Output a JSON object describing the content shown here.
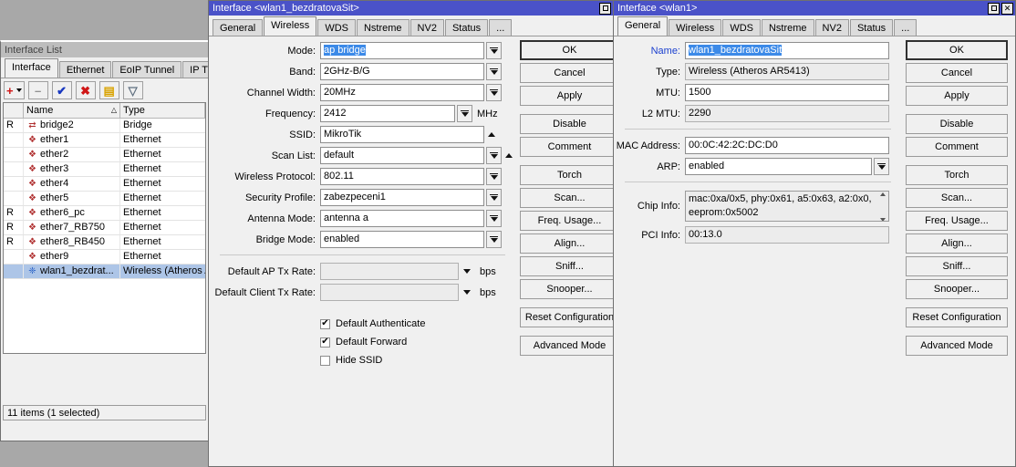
{
  "colors": {
    "title_active": "#4a52c8",
    "title_inactive": "#bdbdbd",
    "selection": "#adc5e7",
    "field_select": "#3c8ae8",
    "modified_label": "#1a3fcf",
    "window_bg": "#f0f0f0",
    "desktop": "#a8a8a8"
  },
  "interface_list": {
    "title": "Interface List",
    "tabs": [
      {
        "label": "Interface",
        "active": true
      },
      {
        "label": "Ethernet",
        "active": false
      },
      {
        "label": "EoIP Tunnel",
        "active": false
      },
      {
        "label": "IP Tunnel",
        "active": false
      }
    ],
    "toolbar": [
      {
        "name": "add-button",
        "icon": "plus-icon",
        "glyph": "+",
        "dropdown": true
      },
      {
        "name": "remove-button",
        "icon": "minus-icon",
        "glyph": "–",
        "dropdown": false
      },
      {
        "name": "enable-button",
        "icon": "check-icon",
        "glyph": "✔",
        "dropdown": false
      },
      {
        "name": "disable-button",
        "icon": "cross-icon",
        "glyph": "✖",
        "dropdown": false
      },
      {
        "name": "comment-button",
        "icon": "folder-icon",
        "glyph": "▤",
        "dropdown": false
      },
      {
        "name": "filter-button",
        "icon": "funnel-icon",
        "glyph": "▽",
        "dropdown": false
      }
    ],
    "columns": [
      "",
      "Name",
      "Type"
    ],
    "sort_indicator": "△",
    "rows": [
      {
        "flag": "R",
        "icon": "bridge-icon",
        "name": "bridge2",
        "type": "Bridge",
        "selected": false
      },
      {
        "flag": "",
        "icon": "ethernet-icon",
        "name": "ether1",
        "type": "Ethernet",
        "selected": false
      },
      {
        "flag": "",
        "icon": "ethernet-icon",
        "name": "ether2",
        "type": "Ethernet",
        "selected": false
      },
      {
        "flag": "",
        "icon": "ethernet-icon",
        "name": "ether3",
        "type": "Ethernet",
        "selected": false
      },
      {
        "flag": "",
        "icon": "ethernet-icon",
        "name": "ether4",
        "type": "Ethernet",
        "selected": false
      },
      {
        "flag": "",
        "icon": "ethernet-icon",
        "name": "ether5",
        "type": "Ethernet",
        "selected": false
      },
      {
        "flag": "R",
        "icon": "ethernet-icon",
        "name": "ether6_pc",
        "type": "Ethernet",
        "selected": false
      },
      {
        "flag": "R",
        "icon": "ethernet-icon",
        "name": "ether7_RB750",
        "type": "Ethernet",
        "selected": false
      },
      {
        "flag": "R",
        "icon": "ethernet-icon",
        "name": "ether8_RB450",
        "type": "Ethernet",
        "selected": false
      },
      {
        "flag": "",
        "icon": "ethernet-icon",
        "name": "ether9",
        "type": "Ethernet",
        "selected": false
      },
      {
        "flag": "",
        "icon": "wireless-icon",
        "name": "wlan1_bezdrat...",
        "type": "Wireless (Atheros A",
        "selected": true
      }
    ],
    "status": "11 items (1 selected)"
  },
  "wireless_dialog": {
    "title": "Interface <wlan1_bezdratovaSit>",
    "window_buttons": {
      "maximize": "□",
      "close": "✕"
    },
    "tabs": [
      {
        "label": "General",
        "active": false
      },
      {
        "label": "Wireless",
        "active": true
      },
      {
        "label": "WDS",
        "active": false
      },
      {
        "label": "Nstreme",
        "active": false
      },
      {
        "label": "NV2",
        "active": false
      },
      {
        "label": "Status",
        "active": false
      },
      {
        "label": "...",
        "active": false
      }
    ],
    "fields": [
      {
        "label": "Mode:",
        "value": "ap bridge",
        "control": "dropdown",
        "selected": true
      },
      {
        "label": "Band:",
        "value": "2GHz-B/G",
        "control": "dropdown"
      },
      {
        "label": "Channel Width:",
        "value": "20MHz",
        "control": "dropdown"
      },
      {
        "label": "Frequency:",
        "value": "2412",
        "control": "dropdown-unit",
        "unit": "MHz"
      },
      {
        "label": "SSID:",
        "value": "MikroTik",
        "control": "collapse"
      },
      {
        "label": "Scan List:",
        "value": "default",
        "control": "dropdown-collapse"
      },
      {
        "label": "Wireless Protocol:",
        "value": "802.11",
        "control": "dropdown"
      },
      {
        "label": "Security Profile:",
        "value": "zabezpeceni1",
        "control": "dropdown"
      },
      {
        "label": "Antenna Mode:",
        "value": "antenna a",
        "control": "dropdown"
      },
      {
        "label": "Bridge Mode:",
        "value": "enabled",
        "control": "dropdown"
      }
    ],
    "rate_fields": [
      {
        "label": "Default AP Tx Rate:",
        "value": "",
        "unit": "bps"
      },
      {
        "label": "Default Client Tx Rate:",
        "value": "",
        "unit": "bps"
      }
    ],
    "checkboxes": [
      {
        "label": "Default Authenticate",
        "checked": true
      },
      {
        "label": "Default Forward",
        "checked": true
      },
      {
        "label": "Hide SSID",
        "checked": false
      }
    ],
    "buttons": [
      {
        "label": "OK",
        "default": true,
        "gap": false
      },
      {
        "label": "Cancel",
        "default": false,
        "gap": false
      },
      {
        "label": "Apply",
        "default": false,
        "gap": false
      },
      {
        "label": "Disable",
        "default": false,
        "gap": true
      },
      {
        "label": "Comment",
        "default": false,
        "gap": false
      },
      {
        "label": "Torch",
        "default": false,
        "gap": true
      },
      {
        "label": "Scan...",
        "default": false,
        "gap": false
      },
      {
        "label": "Freq. Usage...",
        "default": false,
        "gap": false
      },
      {
        "label": "Align...",
        "default": false,
        "gap": false
      },
      {
        "label": "Sniff...",
        "default": false,
        "gap": false
      },
      {
        "label": "Snooper...",
        "default": false,
        "gap": false
      },
      {
        "label": "Reset Configuration",
        "default": false,
        "gap": true
      },
      {
        "label": "Advanced Mode",
        "default": false,
        "gap": true
      }
    ]
  },
  "general_dialog": {
    "title": "Interface <wlan1>",
    "window_buttons": {
      "maximize": "□",
      "close": "✕"
    },
    "tabs": [
      {
        "label": "General",
        "active": true
      },
      {
        "label": "Wireless",
        "active": false
      },
      {
        "label": "WDS",
        "active": false
      },
      {
        "label": "Nstreme",
        "active": false
      },
      {
        "label": "NV2",
        "active": false
      },
      {
        "label": "Status",
        "active": false
      },
      {
        "label": "...",
        "active": false
      }
    ],
    "fields": [
      {
        "label": "Name:",
        "value": "wlan1_bezdratovaSit",
        "readonly": false,
        "modified": true,
        "selected": true
      },
      {
        "label": "Type:",
        "value": "Wireless (Atheros AR5413)",
        "readonly": true,
        "modified": false
      },
      {
        "label": "MTU:",
        "value": "1500",
        "readonly": false,
        "modified": false
      },
      {
        "label": "L2 MTU:",
        "value": "2290",
        "readonly": true,
        "modified": false
      }
    ],
    "mac_fields": [
      {
        "label": "MAC Address:",
        "value": "00:0C:42:2C:DC:D0",
        "control": "text"
      },
      {
        "label": "ARP:",
        "value": "enabled",
        "control": "dropdown"
      }
    ],
    "info_fields": [
      {
        "label": "Chip Info:",
        "value": "mac:0xa/0x5, phy:0x61, a5:0x63, a2:0x0, eeprom:0x5002",
        "control": "multiline"
      },
      {
        "label": "PCI Info:",
        "value": "00:13.0",
        "control": "readonly"
      }
    ],
    "buttons": [
      {
        "label": "OK",
        "default": true,
        "gap": false
      },
      {
        "label": "Cancel",
        "default": false,
        "gap": false
      },
      {
        "label": "Apply",
        "default": false,
        "gap": false
      },
      {
        "label": "Disable",
        "default": false,
        "gap": true
      },
      {
        "label": "Comment",
        "default": false,
        "gap": false
      },
      {
        "label": "Torch",
        "default": false,
        "gap": true
      },
      {
        "label": "Scan...",
        "default": false,
        "gap": false
      },
      {
        "label": "Freq. Usage...",
        "default": false,
        "gap": false
      },
      {
        "label": "Align...",
        "default": false,
        "gap": false
      },
      {
        "label": "Sniff...",
        "default": false,
        "gap": false
      },
      {
        "label": "Snooper...",
        "default": false,
        "gap": false
      },
      {
        "label": "Reset Configuration",
        "default": false,
        "gap": true
      },
      {
        "label": "Advanced Mode",
        "default": false,
        "gap": true
      }
    ]
  }
}
